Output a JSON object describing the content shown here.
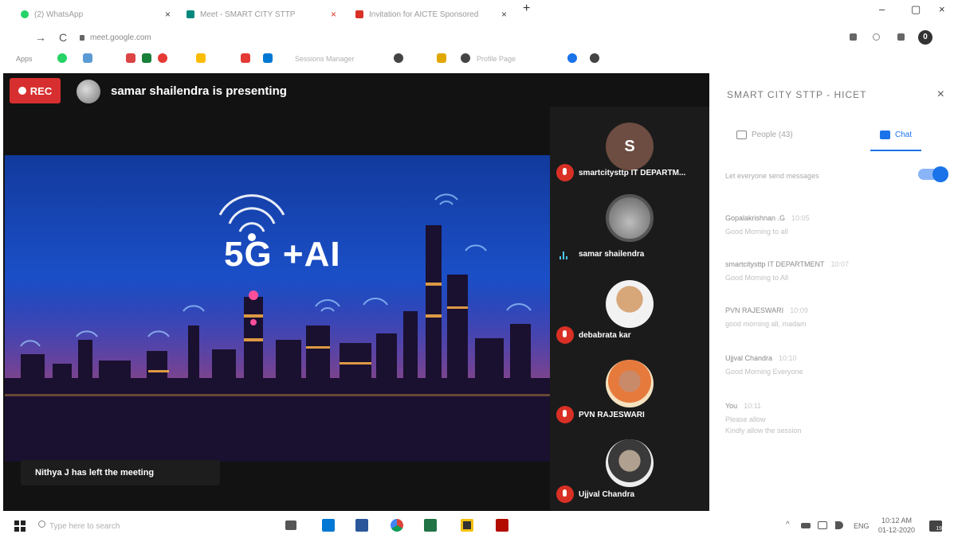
{
  "browser": {
    "tabs": [
      {
        "label": "(2) WhatsApp",
        "color": "#25d366"
      },
      {
        "label": "Meet - SMART CITY STTP",
        "color": "#00897b"
      },
      {
        "label": "Invitation for AICTE Sponsored",
        "color": "#d93025"
      }
    ],
    "new_tab": "+",
    "close": "×",
    "minimize": "–",
    "restore": "▢",
    "close_window": "×",
    "back": "←",
    "forward": "→",
    "reload": "C",
    "url": "meet.google.com",
    "profile_initial": "0",
    "bookmarks": [
      "Apps",
      "Gmail",
      "YouTube",
      "Maps",
      "Sheets",
      "Docs",
      "Drive",
      "Calendar",
      "Skype",
      "Keep",
      "Sessions Manager",
      "Chrome",
      "Hotstar",
      "Profile Page",
      "Google",
      "Chrome Web"
    ]
  },
  "meet": {
    "rec_label": "REC",
    "presenting_text": "samar shailendra is presenting",
    "slide_title": "5G +AI",
    "toast": "Nithya J has left the meeting",
    "participants": [
      {
        "name": "smartcitysttp IT DEPARTM...",
        "initial": "S",
        "muted": true
      },
      {
        "name": "samar shailendra",
        "initial": "",
        "muted": false
      },
      {
        "name": "debabrata kar",
        "initial": "",
        "muted": true
      },
      {
        "name": "PVN RAJESWARI",
        "initial": "",
        "muted": true
      },
      {
        "name": "Ujjval Chandra",
        "initial": "",
        "muted": true
      }
    ]
  },
  "panel": {
    "title": "SMART CITY STTP - HICET",
    "close": "×",
    "tab_people": "People (43)",
    "tab_chat": "Chat",
    "setting": "Let everyone send messages",
    "messages": [
      {
        "name": "Gopalakrishnan .G",
        "time": "10:05",
        "text": "Good Morning to all"
      },
      {
        "name": "smartcitysttp IT DEPARTMENT",
        "time": "10:07",
        "text": "Good Morning to All"
      },
      {
        "name": "PVN RAJESWARI",
        "time": "10:09",
        "text": "good morning all, madam"
      },
      {
        "name": "Ujjval Chandra",
        "time": "10:10",
        "text": "Good Morning Everyone"
      },
      {
        "name": "You",
        "time": "10:11",
        "text": "Please allow"
      },
      {
        "name": "",
        "time": "",
        "text": "Kindly allow the session"
      }
    ]
  },
  "taskbar": {
    "search_placeholder": "Type here to search",
    "tray_lang": "ENG",
    "time": "10:12 AM",
    "date": "01-12-2020",
    "tray_arrow": "^",
    "notification": "19"
  }
}
